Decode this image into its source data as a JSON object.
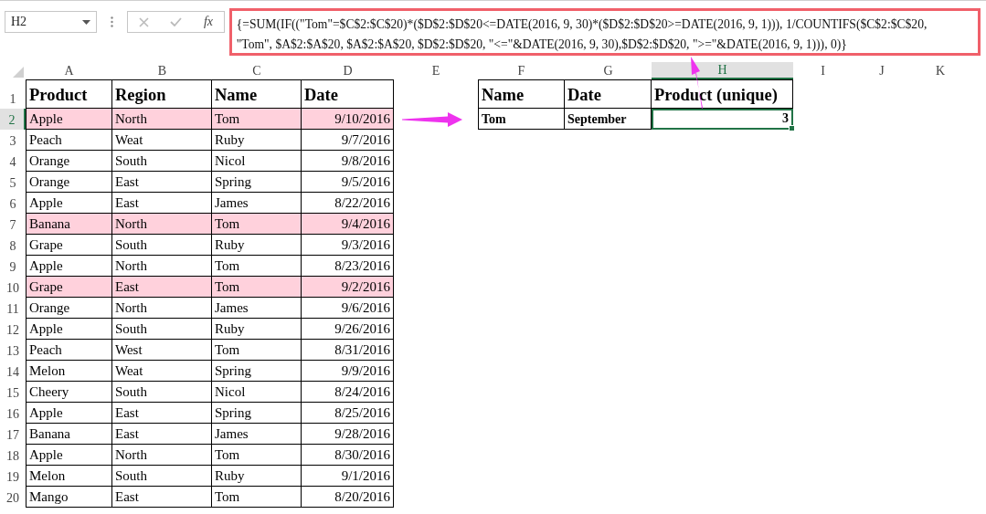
{
  "name_box": {
    "value": "H2"
  },
  "function_label": "fx",
  "formula_lines": [
    "{=SUM(IF((\"Tom\"=$C$2:$C$20)*($D$2:$D$20<=DATE(2016, 9, 30)*($D$2:$D$20>=DATE(2016, 9, 1))), 1/COUNTIFS($C$2:$C$20,",
    "\"Tom\", $A$2:$A$20, $A$2:$A$20, $D$2:$D$20, \"<=\"&DATE(2016, 9, 30),$D$2:$D$20, \">=\"&DATE(2016, 9, 1))), 0)}"
  ],
  "columns": [
    {
      "label": "A",
      "selected": false
    },
    {
      "label": "B",
      "selected": false
    },
    {
      "label": "C",
      "selected": false
    },
    {
      "label": "D",
      "selected": false
    },
    {
      "label": "E",
      "selected": false
    },
    {
      "label": "F",
      "selected": false
    },
    {
      "label": "G",
      "selected": false
    },
    {
      "label": "H",
      "selected": true
    },
    {
      "label": "I",
      "selected": false
    },
    {
      "label": "J",
      "selected": false
    },
    {
      "label": "K",
      "selected": false
    }
  ],
  "rows": [
    {
      "label": "1",
      "selected": false
    },
    {
      "label": "2",
      "selected": true
    },
    {
      "label": "3",
      "selected": false
    },
    {
      "label": "4",
      "selected": false
    },
    {
      "label": "5",
      "selected": false
    },
    {
      "label": "6",
      "selected": false
    },
    {
      "label": "7",
      "selected": false
    },
    {
      "label": "8",
      "selected": false
    },
    {
      "label": "9",
      "selected": false
    },
    {
      "label": "10",
      "selected": false
    },
    {
      "label": "11",
      "selected": false
    },
    {
      "label": "12",
      "selected": false
    },
    {
      "label": "13",
      "selected": false
    },
    {
      "label": "14",
      "selected": false
    },
    {
      "label": "15",
      "selected": false
    },
    {
      "label": "16",
      "selected": false
    },
    {
      "label": "17",
      "selected": false
    },
    {
      "label": "18",
      "selected": false
    },
    {
      "label": "19",
      "selected": false
    },
    {
      "label": "20",
      "selected": false
    }
  ],
  "data_table": {
    "columns": [
      {
        "label": "Product",
        "kind": "text"
      },
      {
        "label": "Region",
        "kind": "text"
      },
      {
        "label": "Name",
        "kind": "text"
      },
      {
        "label": "Date",
        "kind": "date"
      }
    ],
    "rows": [
      {
        "cells": [
          "Apple",
          "North",
          "Tom",
          "9/10/2016"
        ],
        "highlighted": true
      },
      {
        "cells": [
          "Peach",
          "Weat",
          "Ruby",
          "9/7/2016"
        ],
        "highlighted": false
      },
      {
        "cells": [
          "Orange",
          "South",
          "Nicol",
          "9/8/2016"
        ],
        "highlighted": false
      },
      {
        "cells": [
          "Orange",
          "East",
          "Spring",
          "9/5/2016"
        ],
        "highlighted": false
      },
      {
        "cells": [
          "Apple",
          "East",
          "James",
          "8/22/2016"
        ],
        "highlighted": false
      },
      {
        "cells": [
          "Banana",
          "North",
          "Tom",
          "9/4/2016"
        ],
        "highlighted": true
      },
      {
        "cells": [
          "Grape",
          "South",
          "Ruby",
          "9/3/2016"
        ],
        "highlighted": false
      },
      {
        "cells": [
          "Apple",
          "North",
          "Tom",
          "8/23/2016"
        ],
        "highlighted": false
      },
      {
        "cells": [
          "Grape",
          "East",
          "Tom",
          "9/2/2016"
        ],
        "highlighted": true
      },
      {
        "cells": [
          "Orange",
          "North",
          "James",
          "9/6/2016"
        ],
        "highlighted": false
      },
      {
        "cells": [
          "Apple",
          "South",
          "Ruby",
          "9/26/2016"
        ],
        "highlighted": false
      },
      {
        "cells": [
          "Peach",
          "West",
          "Tom",
          "8/31/2016"
        ],
        "highlighted": false
      },
      {
        "cells": [
          "Melon",
          "Weat",
          "Spring",
          "9/9/2016"
        ],
        "highlighted": false
      },
      {
        "cells": [
          "Cheery",
          "South",
          "Nicol",
          "8/24/2016"
        ],
        "highlighted": false
      },
      {
        "cells": [
          "Apple",
          "East",
          "Spring",
          "8/25/2016"
        ],
        "highlighted": false
      },
      {
        "cells": [
          "Banana",
          "East",
          "James",
          "9/28/2016"
        ],
        "highlighted": false
      },
      {
        "cells": [
          "Apple",
          "North",
          "Tom",
          "8/30/2016"
        ],
        "highlighted": false
      },
      {
        "cells": [
          "Melon",
          "South",
          "Ruby",
          "9/1/2016"
        ],
        "highlighted": false
      },
      {
        "cells": [
          "Mango",
          "East",
          "Tom",
          "8/20/2016"
        ],
        "highlighted": false
      }
    ]
  },
  "summary_table": {
    "columns": [
      {
        "label": "Name",
        "kind": "text"
      },
      {
        "label": "Date",
        "kind": "text"
      },
      {
        "label": "Product (unique)",
        "kind": "number"
      }
    ],
    "rows": [
      {
        "cells": [
          "Tom",
          "September",
          "3"
        ],
        "highlighted": false
      }
    ]
  }
}
